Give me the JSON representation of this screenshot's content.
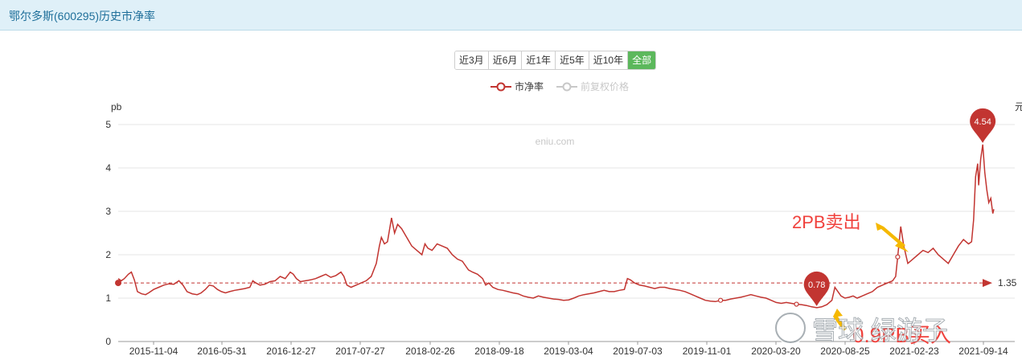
{
  "header": {
    "title": "鄂尔多斯(600295)历史市净率"
  },
  "range_buttons": [
    {
      "label": "近3月",
      "active": false
    },
    {
      "label": "近6月",
      "active": false
    },
    {
      "label": "近1年",
      "active": false
    },
    {
      "label": "近5年",
      "active": false
    },
    {
      "label": "近10年",
      "active": false
    },
    {
      "label": "全部",
      "active": true
    }
  ],
  "legend": [
    {
      "label": "市净率",
      "color": "#c23531",
      "active": true
    },
    {
      "label": "前复权价格",
      "color": "#c8c8c8",
      "active": false
    }
  ],
  "watermark": "eniu.com",
  "annotations": {
    "sell_text": "2PB卖出",
    "buy_text": "0.9PB买入",
    "arrow_color": "#f5b800",
    "text_color": "#f0413c"
  },
  "overlay_watermark": {
    "text": "雪球 绿游子"
  },
  "chart_data": {
    "type": "line",
    "ylabel": "pb",
    "y2label": "元",
    "ylim": [
      0,
      5
    ],
    "yticks": [
      0,
      1,
      2,
      3,
      4,
      5
    ],
    "x_tick_labels": [
      "2015-11-04",
      "2016-05-31",
      "2016-12-27",
      "2017-07-27",
      "2018-02-26",
      "2018-09-18",
      "2019-03-04",
      "2019-07-03",
      "2019-11-01",
      "2020-03-20",
      "2020-08-25",
      "2021-02-23",
      "2021-09-14"
    ],
    "average_line": {
      "value": 1.35,
      "label": "1.35"
    },
    "max_marker": {
      "value": 4.54,
      "label": "4.54"
    },
    "min_marker": {
      "value": 0.78,
      "label": "0.78"
    },
    "series": [
      {
        "color": "#c23531",
        "points": [
          [
            0,
            1.45
          ],
          [
            0.3,
            1.4
          ],
          [
            0.6,
            1.45
          ],
          [
            1.0,
            1.55
          ],
          [
            1.3,
            1.6
          ],
          [
            1.6,
            1.42
          ],
          [
            1.9,
            1.15
          ],
          [
            2.3,
            1.1
          ],
          [
            2.7,
            1.08
          ],
          [
            3.0,
            1.12
          ],
          [
            3.5,
            1.2
          ],
          [
            4.0,
            1.25
          ],
          [
            4.5,
            1.3
          ],
          [
            5.0,
            1.33
          ],
          [
            5.5,
            1.32
          ],
          [
            6.0,
            1.4
          ],
          [
            6.4,
            1.3
          ],
          [
            6.8,
            1.15
          ],
          [
            7.3,
            1.1
          ],
          [
            7.8,
            1.08
          ],
          [
            8.2,
            1.12
          ],
          [
            8.6,
            1.2
          ],
          [
            9.0,
            1.3
          ],
          [
            9.4,
            1.28
          ],
          [
            9.8,
            1.2
          ],
          [
            10.2,
            1.15
          ],
          [
            10.6,
            1.12
          ],
          [
            11.0,
            1.15
          ],
          [
            11.5,
            1.18
          ],
          [
            12.0,
            1.2
          ],
          [
            12.5,
            1.22
          ],
          [
            13.0,
            1.25
          ],
          [
            13.3,
            1.4
          ],
          [
            13.6,
            1.35
          ],
          [
            14.0,
            1.3
          ],
          [
            14.5,
            1.32
          ],
          [
            15.0,
            1.38
          ],
          [
            15.5,
            1.4
          ],
          [
            16.0,
            1.5
          ],
          [
            16.5,
            1.45
          ],
          [
            17.0,
            1.6
          ],
          [
            17.3,
            1.55
          ],
          [
            17.6,
            1.45
          ],
          [
            18.0,
            1.38
          ],
          [
            18.5,
            1.4
          ],
          [
            19.0,
            1.42
          ],
          [
            19.5,
            1.45
          ],
          [
            20.0,
            1.5
          ],
          [
            20.5,
            1.55
          ],
          [
            21.0,
            1.48
          ],
          [
            21.5,
            1.52
          ],
          [
            22.0,
            1.6
          ],
          [
            22.3,
            1.5
          ],
          [
            22.6,
            1.3
          ],
          [
            23.0,
            1.25
          ],
          [
            23.5,
            1.3
          ],
          [
            24.0,
            1.35
          ],
          [
            24.5,
            1.4
          ],
          [
            25.0,
            1.5
          ],
          [
            25.5,
            1.8
          ],
          [
            25.8,
            2.2
          ],
          [
            26.0,
            2.4
          ],
          [
            26.3,
            2.25
          ],
          [
            26.6,
            2.3
          ],
          [
            27.0,
            2.85
          ],
          [
            27.3,
            2.5
          ],
          [
            27.6,
            2.7
          ],
          [
            28.0,
            2.6
          ],
          [
            28.5,
            2.4
          ],
          [
            29.0,
            2.2
          ],
          [
            29.5,
            2.1
          ],
          [
            30.0,
            2.0
          ],
          [
            30.3,
            2.25
          ],
          [
            30.6,
            2.15
          ],
          [
            31.0,
            2.1
          ],
          [
            31.5,
            2.25
          ],
          [
            32.0,
            2.2
          ],
          [
            32.5,
            2.15
          ],
          [
            33.0,
            2.0
          ],
          [
            33.5,
            1.9
          ],
          [
            34.0,
            1.85
          ],
          [
            34.3,
            1.75
          ],
          [
            34.6,
            1.65
          ],
          [
            35.0,
            1.6
          ],
          [
            35.5,
            1.55
          ],
          [
            36.0,
            1.45
          ],
          [
            36.3,
            1.3
          ],
          [
            36.6,
            1.35
          ],
          [
            37.0,
            1.25
          ],
          [
            37.5,
            1.2
          ],
          [
            38.0,
            1.18
          ],
          [
            38.5,
            1.15
          ],
          [
            39.0,
            1.12
          ],
          [
            39.5,
            1.1
          ],
          [
            40.0,
            1.05
          ],
          [
            40.5,
            1.02
          ],
          [
            41.0,
            1.0
          ],
          [
            41.5,
            1.05
          ],
          [
            42.0,
            1.02
          ],
          [
            42.5,
            1.0
          ],
          [
            43.0,
            0.98
          ],
          [
            43.5,
            0.97
          ],
          [
            44.0,
            0.95
          ],
          [
            44.5,
            0.96
          ],
          [
            45.0,
            1.0
          ],
          [
            45.5,
            1.05
          ],
          [
            46.0,
            1.08
          ],
          [
            46.5,
            1.1
          ],
          [
            47.0,
            1.12
          ],
          [
            47.5,
            1.15
          ],
          [
            48.0,
            1.18
          ],
          [
            48.5,
            1.15
          ],
          [
            49.0,
            1.15
          ],
          [
            49.5,
            1.18
          ],
          [
            50.0,
            1.2
          ],
          [
            50.3,
            1.45
          ],
          [
            50.6,
            1.42
          ],
          [
            51.0,
            1.35
          ],
          [
            51.5,
            1.3
          ],
          [
            52.0,
            1.28
          ],
          [
            52.5,
            1.25
          ],
          [
            53.0,
            1.22
          ],
          [
            53.5,
            1.25
          ],
          [
            54.0,
            1.25
          ],
          [
            54.5,
            1.22
          ],
          [
            55.0,
            1.2
          ],
          [
            55.5,
            1.18
          ],
          [
            56.0,
            1.15
          ],
          [
            56.5,
            1.1
          ],
          [
            57.0,
            1.05
          ],
          [
            57.5,
            1.0
          ],
          [
            58.0,
            0.95
          ],
          [
            58.5,
            0.93
          ],
          [
            59.0,
            0.92
          ],
          [
            59.5,
            0.95
          ],
          [
            60.0,
            0.95
          ],
          [
            60.5,
            0.98
          ],
          [
            61.0,
            1.0
          ],
          [
            61.5,
            1.02
          ],
          [
            62.0,
            1.05
          ],
          [
            62.5,
            1.08
          ],
          [
            63.0,
            1.05
          ],
          [
            63.5,
            1.02
          ],
          [
            64.0,
            1.0
          ],
          [
            64.5,
            0.95
          ],
          [
            65.0,
            0.9
          ],
          [
            65.5,
            0.88
          ],
          [
            66.0,
            0.9
          ],
          [
            66.5,
            0.88
          ],
          [
            67.0,
            0.86
          ],
          [
            67.5,
            0.85
          ],
          [
            68.0,
            0.83
          ],
          [
            68.5,
            0.8
          ],
          [
            69.0,
            0.78
          ],
          [
            69.5,
            0.8
          ],
          [
            70.0,
            0.85
          ],
          [
            70.5,
            0.95
          ],
          [
            70.8,
            1.25
          ],
          [
            71.1,
            1.15
          ],
          [
            71.4,
            1.05
          ],
          [
            71.8,
            1.0
          ],
          [
            72.2,
            1.02
          ],
          [
            72.6,
            1.05
          ],
          [
            73.0,
            1.0
          ],
          [
            73.5,
            1.05
          ],
          [
            74.0,
            1.1
          ],
          [
            74.5,
            1.15
          ],
          [
            75.0,
            1.25
          ],
          [
            75.5,
            1.3
          ],
          [
            76.0,
            1.35
          ],
          [
            76.5,
            1.4
          ],
          [
            76.8,
            1.5
          ],
          [
            77.0,
            1.95
          ],
          [
            77.3,
            2.65
          ],
          [
            77.6,
            2.2
          ],
          [
            78.0,
            1.8
          ],
          [
            78.5,
            1.9
          ],
          [
            79.0,
            2.0
          ],
          [
            79.5,
            2.1
          ],
          [
            80.0,
            2.05
          ],
          [
            80.5,
            2.15
          ],
          [
            81.0,
            2.0
          ],
          [
            81.5,
            1.9
          ],
          [
            82.0,
            1.8
          ],
          [
            82.5,
            2.0
          ],
          [
            83.0,
            2.2
          ],
          [
            83.5,
            2.35
          ],
          [
            84.0,
            2.25
          ],
          [
            84.3,
            2.3
          ],
          [
            84.5,
            2.8
          ],
          [
            84.7,
            3.8
          ],
          [
            84.9,
            4.1
          ],
          [
            85.0,
            3.6
          ],
          [
            85.2,
            4.2
          ],
          [
            85.4,
            4.54
          ],
          [
            85.6,
            3.9
          ],
          [
            85.8,
            3.5
          ],
          [
            86.0,
            3.2
          ],
          [
            86.2,
            3.3
          ],
          [
            86.4,
            2.95
          ],
          [
            86.5,
            3.05
          ]
        ]
      }
    ]
  }
}
